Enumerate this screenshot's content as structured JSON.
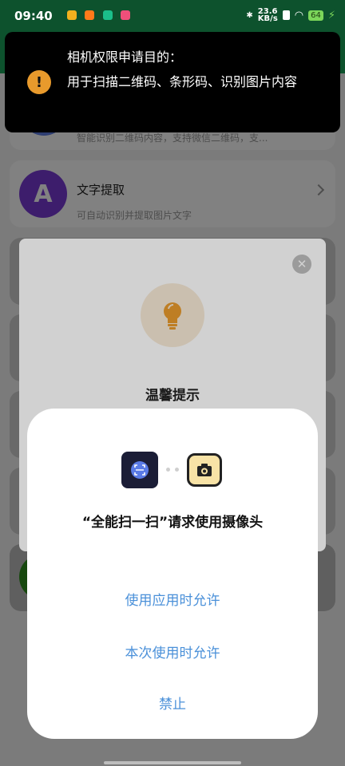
{
  "status_bar": {
    "time": "09:40",
    "net_speed": "23.6\nKB/s",
    "battery": "64"
  },
  "banner": {
    "title": "相机权限申请目的：",
    "body": "用于扫描二维码、条形码、识别图片内容"
  },
  "cards": [
    {
      "title": "",
      "desc": "智能识别二维码内容，支持微信二维码，支..."
    },
    {
      "icon_letter": "A",
      "title": "文字提取",
      "desc": "可自动识别并提取图片文字"
    }
  ],
  "tip_dialog": {
    "title": "温馨提示",
    "close_glyph": "✕"
  },
  "permission": {
    "title": "“全能扫一扫”请求使用摄像头",
    "buttons": [
      "使用应用时允许",
      "本次使用时允许",
      "禁止"
    ]
  },
  "colors": {
    "accent": "#4a90d9",
    "header": "#1aa35a",
    "warning": "#e89a2c"
  }
}
